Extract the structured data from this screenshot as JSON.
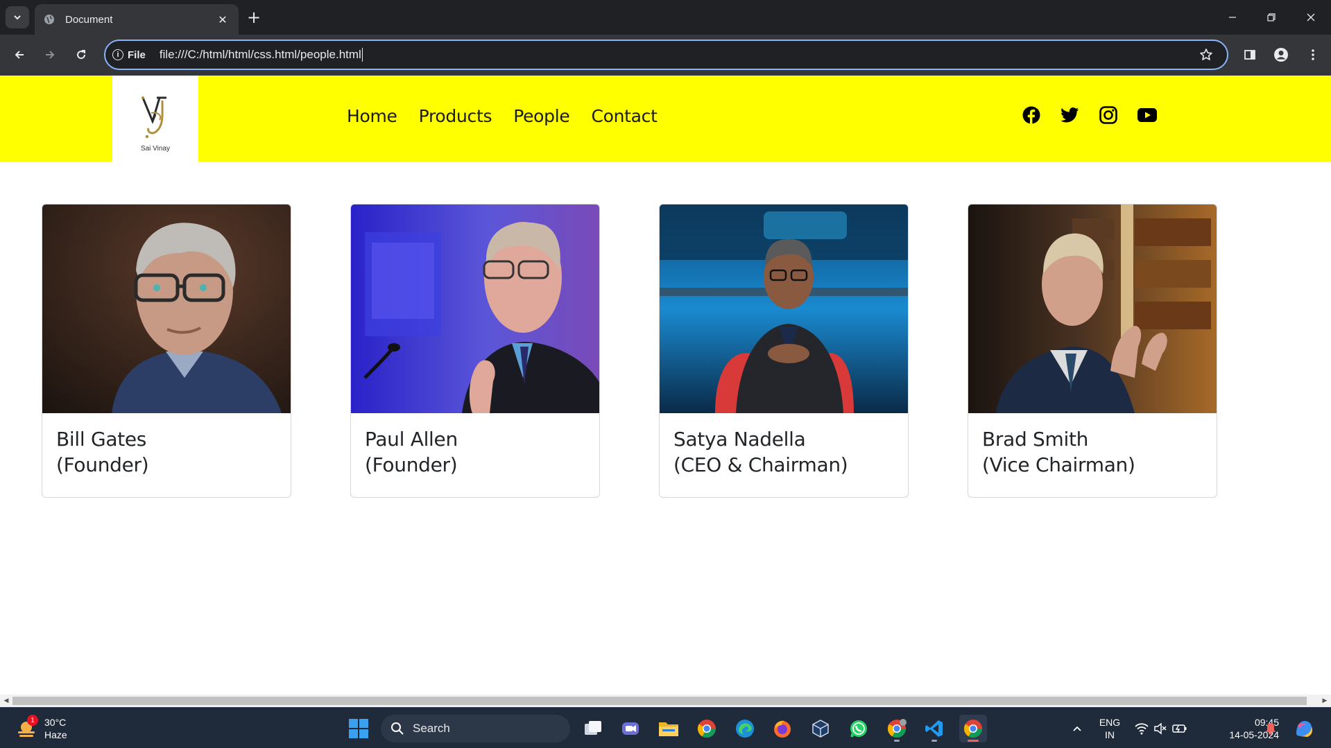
{
  "browser": {
    "tab_title": "Document",
    "url_chip": "File",
    "url": "file:///C:/html/html/css.html/people.html"
  },
  "site": {
    "logo_name": "Sai Vinay",
    "nav": [
      {
        "label": "Home"
      },
      {
        "label": "Products"
      },
      {
        "label": "People"
      },
      {
        "label": "Contact"
      }
    ],
    "social": [
      "facebook-icon",
      "twitter-icon",
      "instagram-icon",
      "youtube-icon"
    ]
  },
  "people": [
    {
      "name": "Bill Gates",
      "role": "(Founder)"
    },
    {
      "name": "Paul Allen",
      "role": "(Founder)"
    },
    {
      "name": "Satya Nadella",
      "role": "(CEO & Chairman)"
    },
    {
      "name": "Brad Smith",
      "role": "(Vice Chairman)"
    }
  ],
  "taskbar": {
    "weather_temp": "30°C",
    "weather_desc": "Haze",
    "weather_badge": "1",
    "search_placeholder": "Search",
    "lang_top": "ENG",
    "lang_bottom": "IN",
    "time": "09:45",
    "date": "14-05-2024"
  },
  "colors": {
    "header_bg": "#ffff00",
    "chrome_dark": "#202124",
    "chrome_toolbar": "#35363a",
    "omnibox_focus": "#8ab4f8",
    "taskbar_bg": "#1f2a3a"
  }
}
